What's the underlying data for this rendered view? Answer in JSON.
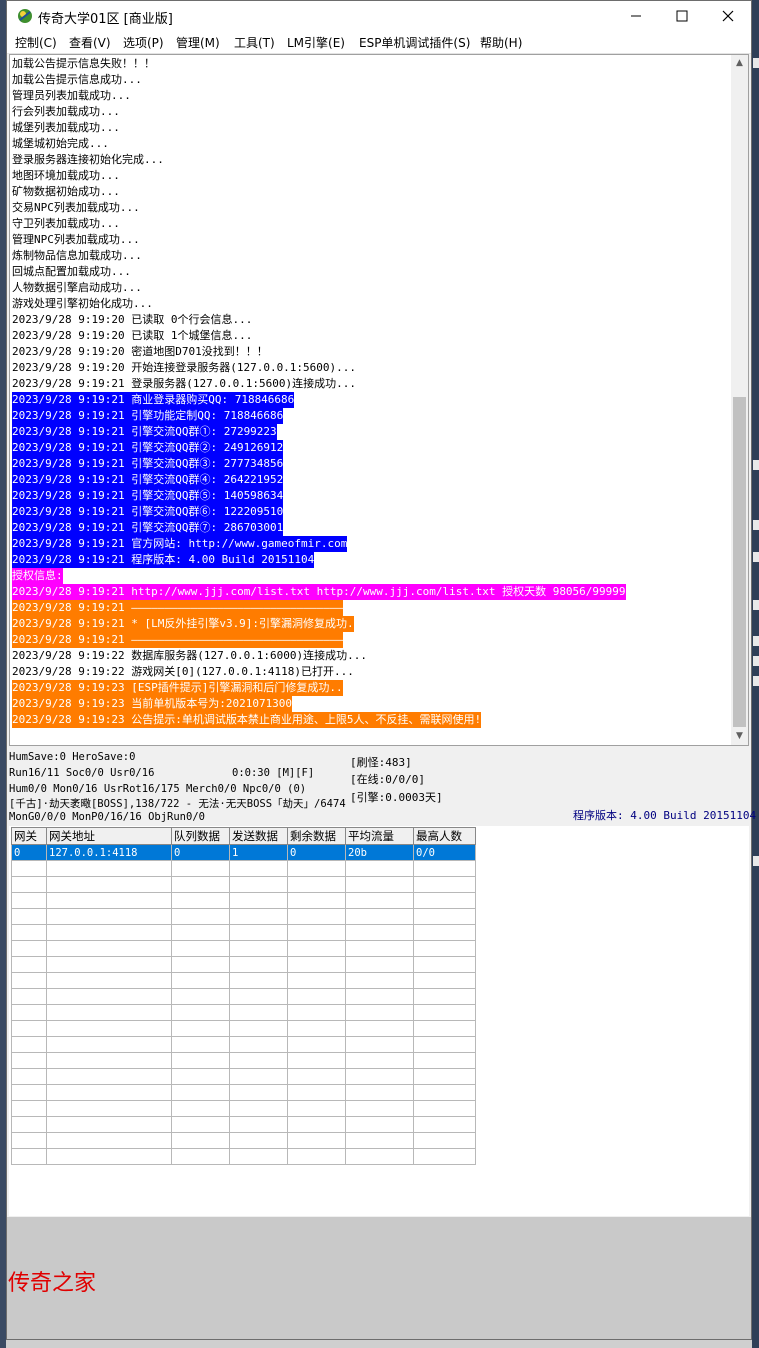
{
  "window": {
    "title": "传奇大学01区 [商业版]"
  },
  "menu": [
    {
      "label": "控制(C)"
    },
    {
      "label": "查看(V)"
    },
    {
      "label": "选项(P)"
    },
    {
      "label": "管理(M)"
    },
    {
      "label": "工具(T)"
    },
    {
      "label": "LM引擎(E)"
    },
    {
      "label": "ESP单机调试插件(S)"
    },
    {
      "label": "帮助(H)"
    }
  ],
  "log": [
    {
      "text": "加载公告提示信息失败！！！",
      "fg": "#000000",
      "bg": ""
    },
    {
      "text": "加载公告提示信息成功...",
      "fg": "#000000",
      "bg": ""
    },
    {
      "text": "管理员列表加载成功...",
      "fg": "#000000",
      "bg": ""
    },
    {
      "text": "行会列表加载成功...",
      "fg": "#000000",
      "bg": ""
    },
    {
      "text": "城堡列表加载成功...",
      "fg": "#000000",
      "bg": ""
    },
    {
      "text": "城堡城初始完成...",
      "fg": "#000000",
      "bg": ""
    },
    {
      "text": "登录服务器连接初始化完成...",
      "fg": "#000000",
      "bg": ""
    },
    {
      "text": "地图环境加载成功...",
      "fg": "#000000",
      "bg": ""
    },
    {
      "text": "矿物数据初始成功...",
      "fg": "#000000",
      "bg": ""
    },
    {
      "text": "交易NPC列表加载成功...",
      "fg": "#000000",
      "bg": ""
    },
    {
      "text": "守卫列表加载成功...",
      "fg": "#000000",
      "bg": ""
    },
    {
      "text": "管理NPC列表加载成功...",
      "fg": "#000000",
      "bg": ""
    },
    {
      "text": "炼制物品信息加载成功...",
      "fg": "#000000",
      "bg": ""
    },
    {
      "text": "回城点配置加载成功...",
      "fg": "#000000",
      "bg": ""
    },
    {
      "text": "人物数据引擎启动成功...",
      "fg": "#000000",
      "bg": ""
    },
    {
      "text": "游戏处理引擎初始化成功...",
      "fg": "#000000",
      "bg": ""
    },
    {
      "text": "2023/9/28 9:19:20 已读取 0个行会信息...",
      "fg": "#000000",
      "bg": ""
    },
    {
      "text": "2023/9/28 9:19:20 已读取 1个城堡信息...",
      "fg": "#000000",
      "bg": ""
    },
    {
      "text": "2023/9/28 9:19:20 密道地图D701没找到！！！",
      "fg": "#000000",
      "bg": ""
    },
    {
      "text": "2023/9/28 9:19:20 开始连接登录服务器(127.0.0.1:5600)...",
      "fg": "#000000",
      "bg": ""
    },
    {
      "text": "2023/9/28 9:19:21 登录服务器(127.0.0.1:5600)连接成功...",
      "fg": "#000000",
      "bg": ""
    },
    {
      "text": "2023/9/28 9:19:21 商业登录器购买QQ: 718846686",
      "fg": "#ffffff",
      "bg": "#0000ff"
    },
    {
      "text": "2023/9/28 9:19:21 引擎功能定制QQ: 718846686",
      "fg": "#ffffff",
      "bg": "#0000ff"
    },
    {
      "text": "2023/9/28 9:19:21 引擎交流QQ群①: 27299223",
      "fg": "#ffffff",
      "bg": "#0000ff"
    },
    {
      "text": "2023/9/28 9:19:21 引擎交流QQ群②: 249126912",
      "fg": "#ffffff",
      "bg": "#0000ff"
    },
    {
      "text": "2023/9/28 9:19:21 引擎交流QQ群③: 277734856",
      "fg": "#ffffff",
      "bg": "#0000ff"
    },
    {
      "text": "2023/9/28 9:19:21 引擎交流QQ群④: 264221952",
      "fg": "#ffffff",
      "bg": "#0000ff"
    },
    {
      "text": "2023/9/28 9:19:21 引擎交流QQ群⑤: 140598634",
      "fg": "#ffffff",
      "bg": "#0000ff"
    },
    {
      "text": "2023/9/28 9:19:21 引擎交流QQ群⑥: 122209510",
      "fg": "#ffffff",
      "bg": "#0000ff"
    },
    {
      "text": "2023/9/28 9:19:21 引擎交流QQ群⑦: 286703001",
      "fg": "#ffffff",
      "bg": "#0000ff"
    },
    {
      "text": "2023/9/28 9:19:21 官方网站: http://www.gameofmir.com",
      "fg": "#ffffff",
      "bg": "#0000ff"
    },
    {
      "text": "2023/9/28 9:19:21 程序版本: 4.00 Build 20151104",
      "fg": "#ffffff",
      "bg": "#0000ff"
    },
    {
      "text": "授权信息:",
      "fg": "#ffffff",
      "bg": "#ff00ff"
    },
    {
      "text": "2023/9/28 9:19:21 http://www.jjj.com/list.txt http://www.jjj.com/list.txt 授权天数 98056/99999",
      "fg": "#ffffff",
      "bg": "#ff00ff"
    },
    {
      "text": "2023/9/28 9:19:21 ————————————————————————————————",
      "fg": "#ffffff",
      "bg": "#ff7c00"
    },
    {
      "text": "2023/9/28 9:19:21 * [LM反外挂引擎v3.9]:引擎漏洞修复成功.",
      "fg": "#ffffff",
      "bg": "#ff7c00"
    },
    {
      "text": "2023/9/28 9:19:21 ————————————————————————————————",
      "fg": "#ffffff",
      "bg": "#ff7c00"
    },
    {
      "text": "2023/9/28 9:19:22 数据库服务器(127.0.0.1:6000)连接成功...",
      "fg": "#000000",
      "bg": ""
    },
    {
      "text": "2023/9/28 9:19:22 游戏网关[0](127.0.0.1:4118)已打开...",
      "fg": "#000000",
      "bg": ""
    },
    {
      "text": "2023/9/28 9:19:23 [ESP插件提示]引擎漏洞和后门修复成功..",
      "fg": "#ffffff",
      "bg": "#ff7c00"
    },
    {
      "text": "2023/9/28 9:19:23 当前单机版本号为:2021071300",
      "fg": "#ffffff",
      "bg": "#ff7c00"
    },
    {
      "text": "2023/9/28 9:19:23 公告提示:单机调试版本禁止商业用途、上限5人、不反挂、需联网使用!",
      "fg": "#ffffff",
      "bg": "#ff7c00"
    }
  ],
  "status": {
    "line1": "HumSave:0 HeroSave:0",
    "line2": "Run16/11 Soc0/0 Usr0/16",
    "uptime": "0:0:30 [M][F]",
    "line3": "Hum0/0 Mon0/16 UsrRot16/175 Merch0/0 Npc0/0 (0)",
    "line4": "[千古]·劫天袤曔[BOSS],138/722 - 无法·无天BOSS「劫天」/6474",
    "line5": "MonG0/0/0 MonP0/16/16 ObjRun0/0",
    "refresh": "[刷怪:483]",
    "online": "[在线:0/0/0]",
    "engine": "[引擎:0.0003天]",
    "version": "程序版本: 4.00 Build 20151104"
  },
  "grid": {
    "headers": [
      "网关",
      "网关地址",
      "队列数据",
      "发送数据",
      "剩余数据",
      "平均流量",
      "最高人数"
    ],
    "rows": [
      [
        "0",
        "127.0.0.1:4118",
        "0",
        "1",
        "0",
        "20b",
        "0/0"
      ]
    ]
  },
  "watermark": "传奇之家",
  "colors": {
    "highlight_blue": "#0000ff",
    "magenta": "#ff00ff",
    "orange": "#ff7c00",
    "selected_row": "#0078d7",
    "watermark": "#e00000"
  }
}
